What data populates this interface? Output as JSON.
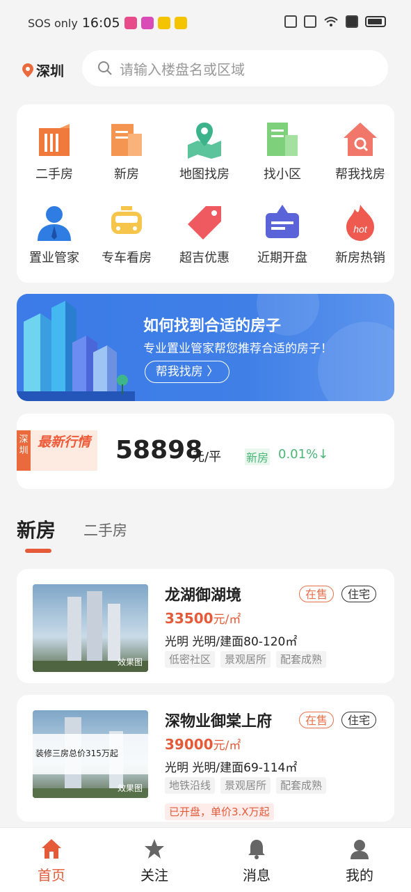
{
  "status": {
    "carrier": "SOS only",
    "time": "16:05"
  },
  "header": {
    "city": "深圳",
    "search_placeholder": "请输入楼盘名或区域"
  },
  "grid": [
    {
      "label": "二手房",
      "icon": "building-icon"
    },
    {
      "label": "新房",
      "icon": "new-house-icon"
    },
    {
      "label": "地图找房",
      "icon": "map-pin-icon"
    },
    {
      "label": "找小区",
      "icon": "community-icon"
    },
    {
      "label": "帮我找房",
      "icon": "house-search-icon"
    },
    {
      "label": "置业管家",
      "icon": "agent-icon"
    },
    {
      "label": "专车看房",
      "icon": "taxi-icon"
    },
    {
      "label": "超吉优惠",
      "icon": "discount-tag-icon"
    },
    {
      "label": "近期开盘",
      "icon": "sign-icon"
    },
    {
      "label": "新房热销",
      "icon": "hot-icon"
    }
  ],
  "banner": {
    "title": "如何找到合适的房子",
    "subtitle": "专业置业管家帮您推荐合适的房子！",
    "button": "帮我找房 〉"
  },
  "market": {
    "city_tag": "深圳",
    "label": "最新行情",
    "price": "58898",
    "unit": "元/平",
    "type": "新房",
    "change": "0.01%↓"
  },
  "tabs": {
    "active": "新房",
    "inactive": "二手房"
  },
  "listings": [
    {
      "name": "龙湖御湖境",
      "status": "在售",
      "type": "住宅",
      "price": "33500",
      "price_unit": "元/㎡",
      "address": "光明 光明/建面80-120㎡",
      "tags": [
        "低密社区",
        "景观居所",
        "配套成熟"
      ],
      "photo_label": "效果图"
    },
    {
      "name": "深物业御棠上府",
      "status": "在售",
      "type": "住宅",
      "price": "39000",
      "price_unit": "元/㎡",
      "address": "光明 光明/建面69-114㎡",
      "tags": [
        "地铁沿线",
        "景观居所",
        "配套成熟"
      ],
      "photo_label": "效果图",
      "promo": "装修三房总价315万起",
      "note": "已开盘，单价3.X万起"
    }
  ],
  "nav": [
    {
      "label": "首页",
      "icon": "home-icon"
    },
    {
      "label": "关注",
      "icon": "star-icon"
    },
    {
      "label": "消息",
      "icon": "bell-icon"
    },
    {
      "label": "我的",
      "icon": "user-icon"
    }
  ],
  "colors": {
    "accent": "#e55b3a",
    "banner": "#3c7be8",
    "green": "#4bb678"
  }
}
